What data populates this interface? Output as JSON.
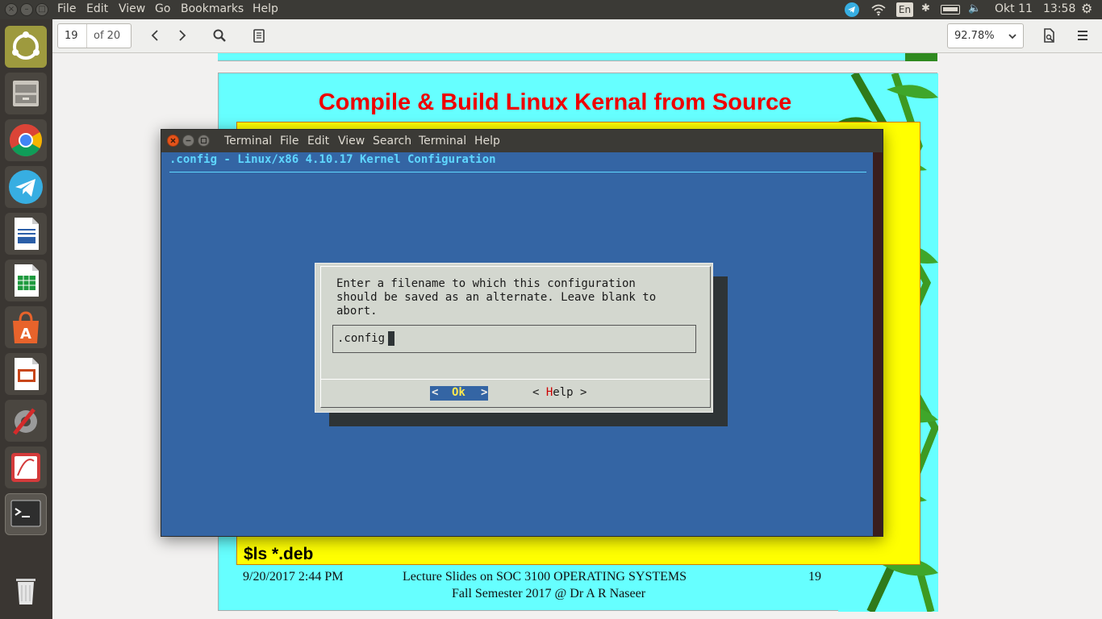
{
  "top_menu": [
    "File",
    "Edit",
    "View",
    "Go",
    "Bookmarks",
    "Help"
  ],
  "tray": {
    "keyboard": "En",
    "date": "Okt 11",
    "time": "13:58"
  },
  "toolbar": {
    "page_current": "19",
    "page_total": "of 20",
    "zoom": "92.78%"
  },
  "slide": {
    "title": "Compile & Build Linux Kernal from Source",
    "command": "$ls  *.deb",
    "footer_date": "9/20/2017 2:44 PM",
    "footer_course": "Lecture Slides on SOC 3100 OPERATING SYSTEMS",
    "footer_page": "19",
    "footer_semester": "Fall Semester 2017 @ Dr A R Naseer"
  },
  "terminal": {
    "menu": [
      "Terminal",
      "File",
      "Edit",
      "View",
      "Search",
      "Terminal",
      "Help"
    ],
    "header": ".config - Linux/x86 4.10.17 Kernel Configuration",
    "dialog": {
      "line1": "Enter a filename to which this configuration",
      "line2": "should be saved as an alternate.  Leave blank to",
      "line3": "abort.",
      "input_value": ".config",
      "ok_open": "<",
      "ok_label": "Ok",
      "ok_close": ">",
      "help_open": "< ",
      "help_hotkey": "H",
      "help_rest": "elp >"
    }
  },
  "colors": {
    "slide_bg": "#66ffff",
    "slide_title": "#ee0000",
    "slide_box": "#ffff00",
    "terminal_bg": "#3465a4",
    "header_text": "#5fd7ff",
    "dialog_bg": "#d3d7cf",
    "ok_bg": "#3465a4",
    "ok_text": "#fce94f",
    "help_hotkey": "#cc0000"
  }
}
